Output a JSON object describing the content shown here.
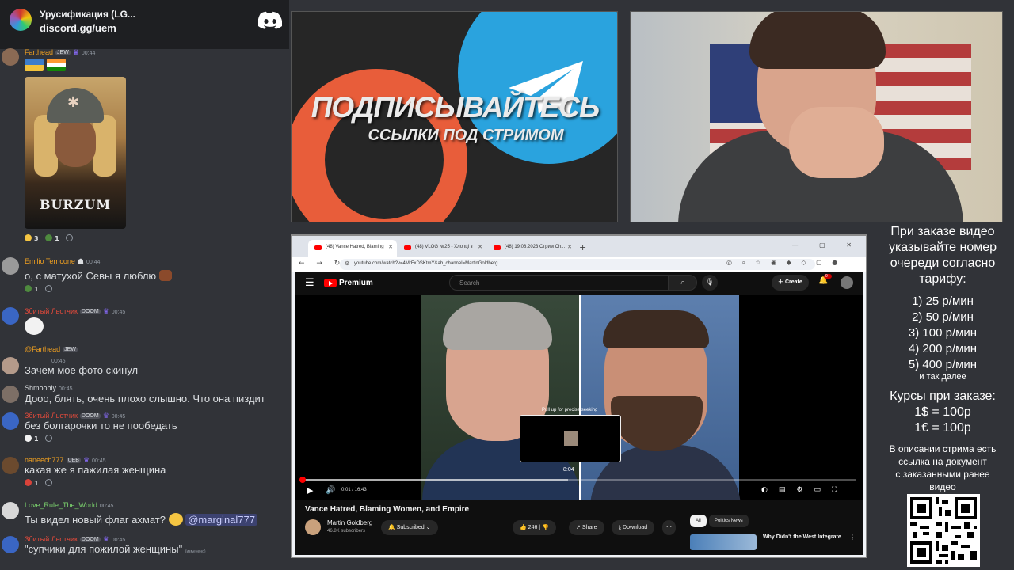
{
  "discord": {
    "server_name": "Урусификация (LG...",
    "server_invite": "discord.gg/uem",
    "messages": [
      {
        "user": "Farthead",
        "badge": "JEW",
        "time": "00:44",
        "reactions": [
          "3",
          "1"
        ],
        "attachment": {
          "image_text": "BURZUM"
        }
      },
      {
        "user": "Emilio Terricone",
        "time": "00:44",
        "text": "о, с матухой Севы я люблю",
        "reactions": [
          "1"
        ]
      },
      {
        "user": "Збитый Льотчик",
        "badge": "DOOM",
        "time": "00:45"
      },
      {
        "reply_to": "@Farthead",
        "reply_badge": "JEW",
        "time": "00:45",
        "text": "Зачем мое фото скинул"
      },
      {
        "user": "Shmoobly",
        "time": "00:45",
        "text": "Дооо, блять, очень плохо слышно. Что она пиздит"
      },
      {
        "user": "Збитый Льотчик",
        "badge": "DOOM",
        "time": "00:45",
        "text": "без болгарочки то не пообедать",
        "reactions": [
          "1"
        ]
      },
      {
        "user": "naneech777",
        "badge": "UEB",
        "time": "00:45",
        "text": "какая же я пажилая женщина",
        "reactions": [
          "1"
        ]
      },
      {
        "user": "Love_Rule_The_World",
        "time": "00:45",
        "text": "Ты видел новый флаг ахмат?",
        "mention": "@marginal777"
      },
      {
        "user": "Збитый Льотчик",
        "badge": "DOOM",
        "time": "00:45",
        "text": "\"супчики для пожилой женщины\"",
        "edited": "(изменено)"
      }
    ]
  },
  "promo": {
    "title": "ПОДПИСЫВАЙТЕСЬ",
    "subtitle": "ССЫЛКИ ПОД СТРИМОМ"
  },
  "browser": {
    "tabs": [
      "(48) Vance Hatred, Blaming",
      "(48) VLOG №25 - Хлопці з",
      "(48) 19.08.2023 Стрим Ch..."
    ],
    "url": "youtube.com/watch?v=4MrFxDSKtmY&ab_channel=MartinGoldberg",
    "youtube": {
      "brand": "Premium",
      "search_placeholder": "Search",
      "create_label": "Create",
      "notifications": "9+",
      "seek_tip": "Pull up for precise seeking",
      "preview_time": "8:04",
      "time_display": "0:01 / 16:43",
      "progress": {
        "played": 0.001,
        "hover": 0.48
      },
      "video_title": "Vance Hatred, Blaming Women, and Empire",
      "channel_name": "Martin Goldberg",
      "subscribers": "46.8K subscribers",
      "subscribed_label": "Subscribed",
      "likes": "246",
      "share_label": "Share",
      "download_label": "Download",
      "chip_all": "All",
      "chip_politics": "Politics News",
      "rec_title": "Why Didn't the West Integrate"
    }
  },
  "info": {
    "lines": [
      "При заказе видео",
      "указывайте номер",
      "очереди согласно",
      "тарифу:"
    ],
    "tariffs": [
      "1) 25 р/мин",
      "2) 50 р/мин",
      "3) 100 р/мин",
      "4) 200 р/мин",
      "5) 400 р/мин"
    ],
    "etc": "и так далее",
    "rates_title": "Курсы при заказе:",
    "rates": [
      "1$ = 100р",
      "1€ = 100р"
    ],
    "desc_lines": [
      "В описании стрима есть",
      "ссылка на документ",
      "с заказанными ранее",
      "видео"
    ]
  },
  "colors": {
    "discord_bg": "#313338",
    "username_orange": "#f0a020",
    "username_green": "#7bd36d",
    "username_red": "#e24a3b",
    "mention_bg": "#3c4270",
    "youtube_red": "#ff0000",
    "telegram_blue": "#2aa3de",
    "patreon_orange": "#e85d3a"
  }
}
